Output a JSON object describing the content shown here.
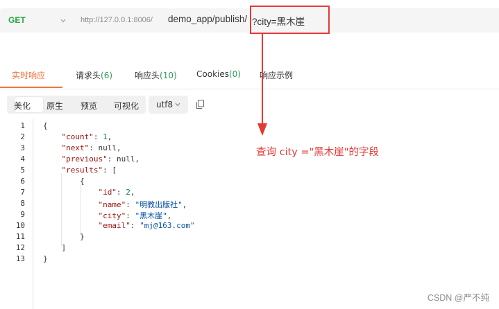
{
  "request": {
    "method": "GET",
    "url_host": "http://127.0.0.1:8006/",
    "url_path": "demo_app/publish/",
    "url_query": "?city=黑木崖"
  },
  "tabs": [
    {
      "label": "实时响应",
      "count": ""
    },
    {
      "label": "请求头",
      "count": "(6)"
    },
    {
      "label": "响应头",
      "count": "(10)"
    },
    {
      "label": "Cookies",
      "count": "(0)"
    },
    {
      "label": "响应示例",
      "count": ""
    }
  ],
  "view_modes": [
    "美化",
    "原生",
    "预览",
    "可视化"
  ],
  "encoding": "utf8",
  "code": {
    "line_numbers": [
      "1",
      "2",
      "3",
      "4",
      "5",
      "6",
      "7",
      "8",
      "9",
      "10",
      "11",
      "12",
      "13"
    ],
    "lines": [
      [
        {
          "t": "p",
          "v": "{"
        }
      ],
      [
        {
          "t": "p",
          "v": "    "
        },
        {
          "t": "k",
          "v": "\"count\""
        },
        {
          "t": "p",
          "v": ": "
        },
        {
          "t": "n",
          "v": "1"
        },
        {
          "t": "p",
          "v": ","
        }
      ],
      [
        {
          "t": "p",
          "v": "    "
        },
        {
          "t": "k",
          "v": "\"next\""
        },
        {
          "t": "p",
          "v": ": "
        },
        {
          "t": "p",
          "v": "null"
        },
        {
          "t": "p",
          "v": ","
        }
      ],
      [
        {
          "t": "p",
          "v": "    "
        },
        {
          "t": "k",
          "v": "\"previous\""
        },
        {
          "t": "p",
          "v": ": "
        },
        {
          "t": "p",
          "v": "null"
        },
        {
          "t": "p",
          "v": ","
        }
      ],
      [
        {
          "t": "p",
          "v": "    "
        },
        {
          "t": "k",
          "v": "\"results\""
        },
        {
          "t": "p",
          "v": ": ["
        }
      ],
      [
        {
          "t": "p",
          "v": "        {"
        }
      ],
      [
        {
          "t": "p",
          "v": "            "
        },
        {
          "t": "k",
          "v": "\"id\""
        },
        {
          "t": "p",
          "v": ": "
        },
        {
          "t": "n",
          "v": "2"
        },
        {
          "t": "p",
          "v": ","
        }
      ],
      [
        {
          "t": "p",
          "v": "            "
        },
        {
          "t": "k",
          "v": "\"name\""
        },
        {
          "t": "p",
          "v": ": "
        },
        {
          "t": "s",
          "v": "\"明教出版社\""
        },
        {
          "t": "p",
          "v": ","
        }
      ],
      [
        {
          "t": "p",
          "v": "            "
        },
        {
          "t": "k",
          "v": "\"city\""
        },
        {
          "t": "p",
          "v": ": "
        },
        {
          "t": "s",
          "v": "\"黑木崖\""
        },
        {
          "t": "p",
          "v": ","
        }
      ],
      [
        {
          "t": "p",
          "v": "            "
        },
        {
          "t": "k",
          "v": "\"email\""
        },
        {
          "t": "p",
          "v": ": "
        },
        {
          "t": "s",
          "v": "\"mj@163.com\""
        }
      ],
      [
        {
          "t": "p",
          "v": "        }"
        }
      ],
      [
        {
          "t": "p",
          "v": "    ]"
        }
      ],
      [
        {
          "t": "p",
          "v": "}"
        }
      ]
    ]
  },
  "annotation": "查询  city =\"黑木崖\"的字段",
  "watermark": "CSDN @严不纯",
  "colors": {
    "accent": "#f1753e",
    "method_get": "#28a745",
    "annotation_red": "#e53935"
  },
  "icons": [
    "chevron-down-icon",
    "copy-icon",
    "arrow-down-icon"
  ]
}
